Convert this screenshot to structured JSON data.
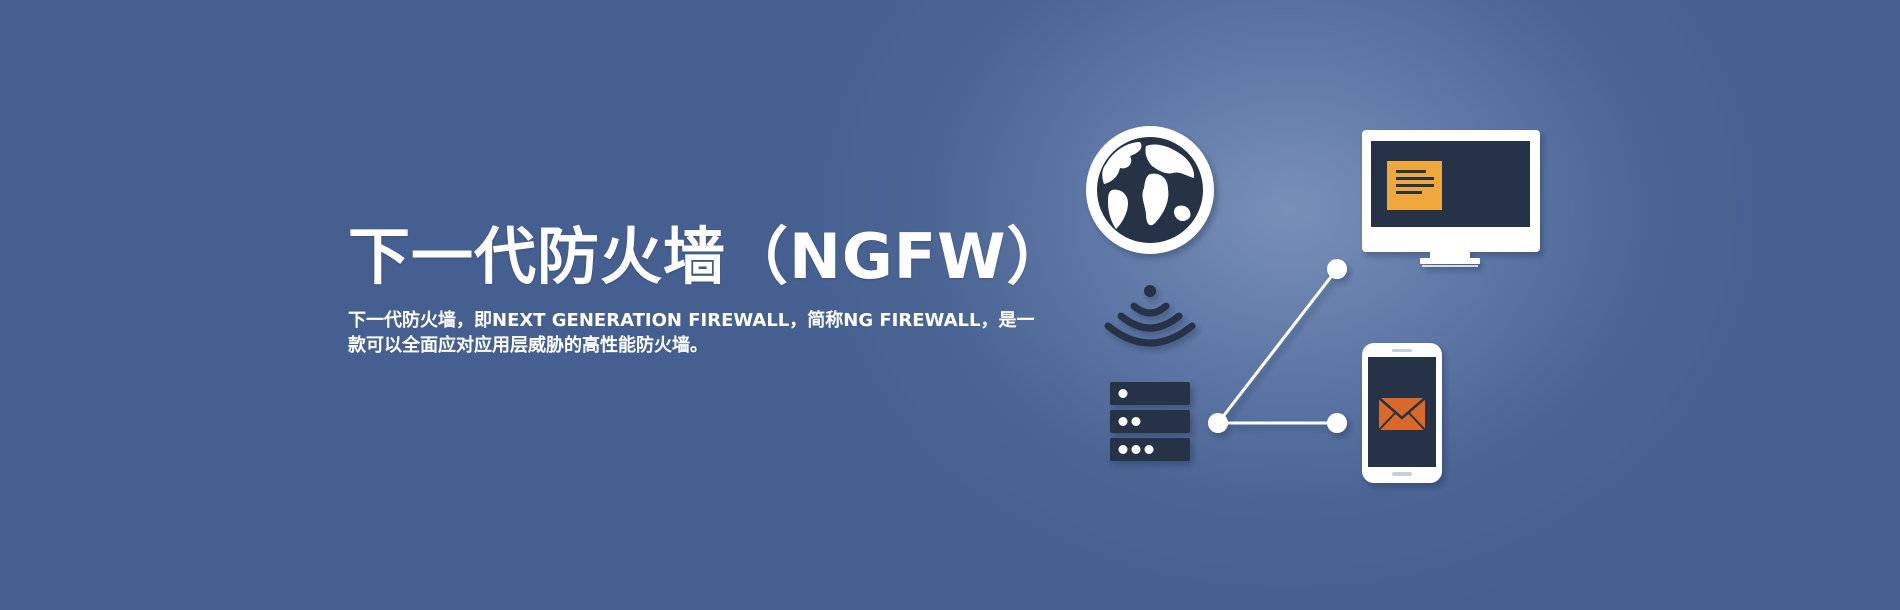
{
  "hero": {
    "title": "下一代防火墙（NGFW）",
    "description": "下一代防火墙，即NEXT GENERATION FIREWALL，简称NG FIREWALL，是一款可以全面应对应用层威胁的高性能防火墙。"
  },
  "illustration": {
    "icons": [
      "globe-icon",
      "wifi-icon",
      "server-icon",
      "monitor-icon",
      "smartphone-icon",
      "document-icon",
      "envelope-icon",
      "network-link"
    ],
    "colors": {
      "background": "#4a6494",
      "highlight": "#7890b8",
      "dark": "#253244",
      "document": "#f0a83c",
      "envelope": "#d8692b",
      "white": "#ffffff"
    }
  }
}
